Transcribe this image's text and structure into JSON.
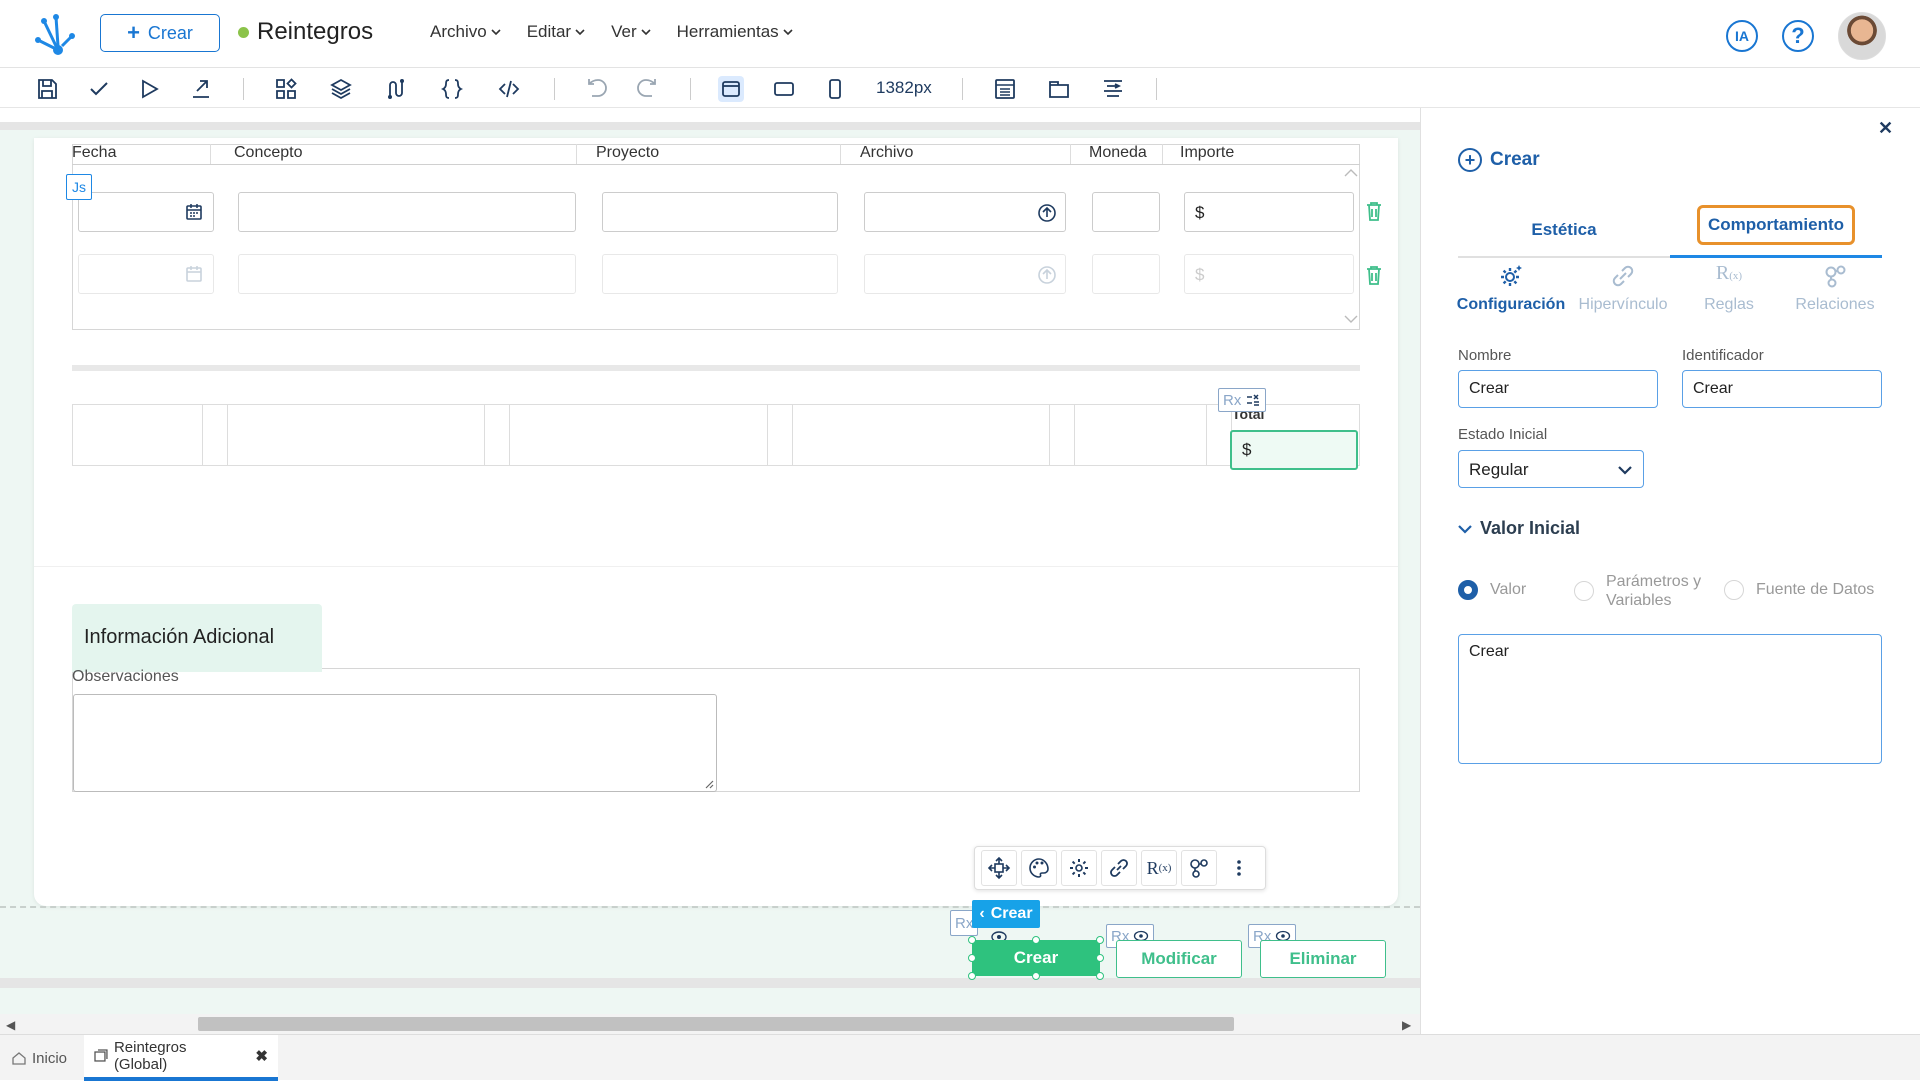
{
  "header": {
    "create_label": "Crear",
    "app_title": "Reintegros",
    "menu": [
      {
        "label": "Archivo"
      },
      {
        "label": "Editar"
      },
      {
        "label": "Ver"
      },
      {
        "label": "Herramientas"
      }
    ],
    "ai_label": "IA",
    "help_label": "?"
  },
  "toolbar": {
    "zoom": "1382px"
  },
  "grid": {
    "columns": [
      "Fecha",
      "Concepto",
      "Proyecto",
      "Archivo",
      "Moneda",
      "Importe"
    ],
    "currency_symbol": "$",
    "js_tag": "Js"
  },
  "totals": {
    "label": "Total",
    "currency_symbol": "$",
    "rx": "Rx"
  },
  "info": {
    "section_title": "Información Adicional",
    "obs_label": "Observaciones"
  },
  "actions": {
    "crear_tag": "Crear",
    "crear": "Crear",
    "modificar": "Modificar",
    "eliminar": "Eliminar",
    "rx": "Rx"
  },
  "bottom_tabs": {
    "home": "Inicio",
    "doc": "Reintegros (Global)"
  },
  "panel": {
    "title": "Crear",
    "tabs": {
      "estetica": "Estética",
      "comportamiento": "Comportamiento"
    },
    "subtabs": {
      "config": "Configuración",
      "hyperlink": "Hipervínculo",
      "rules": "Reglas",
      "relations": "Relaciones"
    },
    "nombre_label": "Nombre",
    "nombre_value": "Crear",
    "id_label": "Identificador",
    "id_value": "Crear",
    "estado_label": "Estado Inicial",
    "estado_value": "Regular",
    "valor_inicial": "Valor Inicial",
    "radio_valor": "Valor",
    "radio_params_1": "Parámetros y",
    "radio_params_2": "Variables",
    "radio_fuente": "Fuente de Datos",
    "valor_text": "Crear"
  },
  "colors": {
    "accent": "#1976d2",
    "green": "#2ec27e",
    "highlight": "#e8912b"
  }
}
